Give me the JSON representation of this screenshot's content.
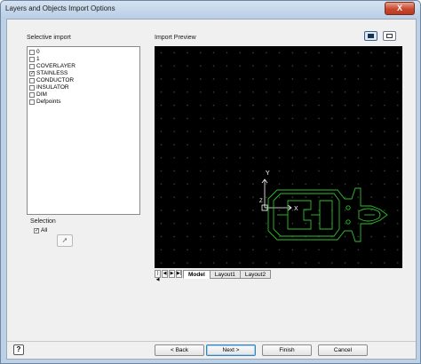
{
  "window": {
    "title": "Layers and Objects Import Options",
    "close_label": "X"
  },
  "selective_import": {
    "heading": "Selective import",
    "layers": [
      {
        "label": "0",
        "checked": false
      },
      {
        "label": "1",
        "checked": false
      },
      {
        "label": "COVERLAYER",
        "checked": false
      },
      {
        "label": "STAINLESS",
        "checked": true
      },
      {
        "label": "CONDUCTOR",
        "checked": false
      },
      {
        "label": "INSULATOR",
        "checked": false
      },
      {
        "label": "DIM",
        "checked": false
      },
      {
        "label": "Defpoints",
        "checked": false
      }
    ]
  },
  "selection": {
    "heading": "Selection",
    "all_label": "All",
    "all_checked": true
  },
  "preview": {
    "heading": "Import Preview",
    "axis_y": "Y",
    "axis_x": "X",
    "axis_z": "Z"
  },
  "layout_tabs": {
    "nav_glyphs": [
      "|◀",
      "◀",
      "▶",
      "▶|"
    ],
    "tabs": [
      {
        "label": "Model",
        "active": true
      },
      {
        "label": "Layout1",
        "active": false
      },
      {
        "label": "Layout2",
        "active": false
      }
    ]
  },
  "buttons": {
    "back": "< Back",
    "next": "Next >",
    "finish": "Finish",
    "cancel": "Cancel"
  },
  "help_glyph": "?",
  "colors": {
    "preview_bg": "#000000",
    "drawing": "#2fbf2f",
    "axis": "#ffffff"
  }
}
